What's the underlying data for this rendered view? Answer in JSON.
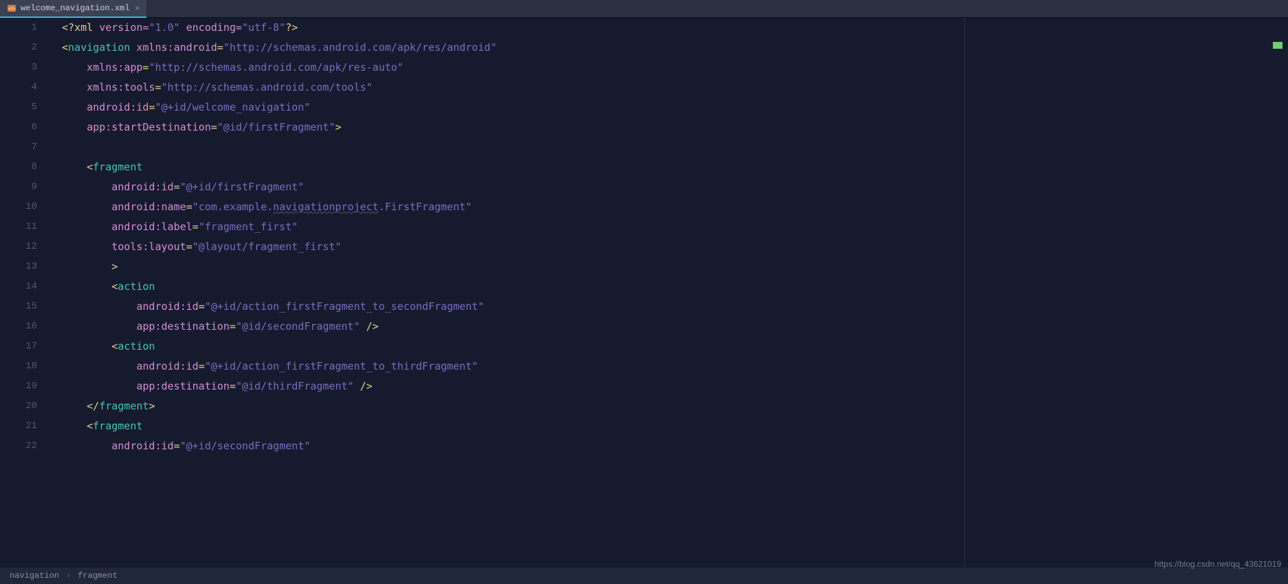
{
  "tab": {
    "filename": "welcome_navigation.xml",
    "icon_name": "xml-file-icon"
  },
  "gutter": {
    "count": 22
  },
  "code": {
    "l1": {
      "open": "<?",
      "kw": "xml",
      "sp": " ",
      "a1": "version=",
      "v1": "\"1.0\"",
      "sp2": " ",
      "a2": "encoding=",
      "v2": "\"utf-8\"",
      "close": "?>"
    },
    "l2": {
      "lt": "<",
      "tag": "navigation",
      "sp": " ",
      "ns": "xmlns:",
      "attr": "android",
      "eq": "=",
      "val": "\"http://schemas.android.com/apk/res/android\""
    },
    "l3": {
      "pad": "    ",
      "ns": "xmlns:",
      "attr": "app",
      "eq": "=",
      "val": "\"http://schemas.android.com/apk/res-auto\""
    },
    "l4": {
      "pad": "    ",
      "ns": "xmlns:",
      "attr": "tools",
      "eq": "=",
      "val": "\"http://schemas.android.com/tools\""
    },
    "l5": {
      "pad": "    ",
      "ns": "android:",
      "attr": "id",
      "eq": "=",
      "val": "\"@+id/welcome_navigation\""
    },
    "l6": {
      "pad": "    ",
      "ns": "app:",
      "attr": "startDestination",
      "eq": "=",
      "val": "\"@id/firstFragment\"",
      "gt": ">"
    },
    "l7": {
      "blank": " "
    },
    "l8": {
      "pad": "    ",
      "lt": "<",
      "tag": "fragment"
    },
    "l9": {
      "pad": "        ",
      "ns": "android:",
      "attr": "id",
      "eq": "=",
      "val": "\"@+id/firstFragment\""
    },
    "l10": {
      "pad": "        ",
      "ns": "android:",
      "attr": "name",
      "eq": "=",
      "qo": "\"",
      "p1": "com.example.",
      "ul": "navigationproject",
      "p2": ".FirstFragment",
      "qc": "\""
    },
    "l11": {
      "pad": "        ",
      "ns": "android:",
      "attr": "label",
      "eq": "=",
      "val": "\"fragment_first\""
    },
    "l12": {
      "pad": "        ",
      "ns": "tools:",
      "attr": "layout",
      "eq": "=",
      "val": "\"@layout/fragment_first\""
    },
    "l13": {
      "pad": "        ",
      "gt": ">"
    },
    "l14": {
      "pad": "        ",
      "lt": "<",
      "tag": "action"
    },
    "l15": {
      "pad": "            ",
      "ns": "android:",
      "attr": "id",
      "eq": "=",
      "val": "\"@+id/action_firstFragment_to_secondFragment\""
    },
    "l16": {
      "pad": "            ",
      "ns": "app:",
      "attr": "destination",
      "eq": "=",
      "val": "\"@id/secondFragment\"",
      "sp": " ",
      "close": "/>"
    },
    "l17": {
      "pad": "        ",
      "lt": "<",
      "tag": "action"
    },
    "l18": {
      "pad": "            ",
      "ns": "android:",
      "attr": "id",
      "eq": "=",
      "val": "\"@+id/action_firstFragment_to_thirdFragment\""
    },
    "l19": {
      "pad": "            ",
      "ns": "app:",
      "attr": "destination",
      "eq": "=",
      "val": "\"@id/thirdFragment\"",
      "sp": " ",
      "close": "/>"
    },
    "l20": {
      "pad": "    ",
      "lt": "</",
      "tag": "fragment",
      "gt": ">"
    },
    "l21": {
      "pad": "    ",
      "lt": "<",
      "tag": "fragment"
    },
    "l22": {
      "pad": "        ",
      "ns": "android:",
      "attr": "id",
      "eq": "=",
      "val": "\"@+id/secondFragment\""
    }
  },
  "breadcrumb": {
    "a": "navigation",
    "sep": "›",
    "b": "fragment"
  },
  "watermark": "https://blog.csdn.net/qq_43621019"
}
